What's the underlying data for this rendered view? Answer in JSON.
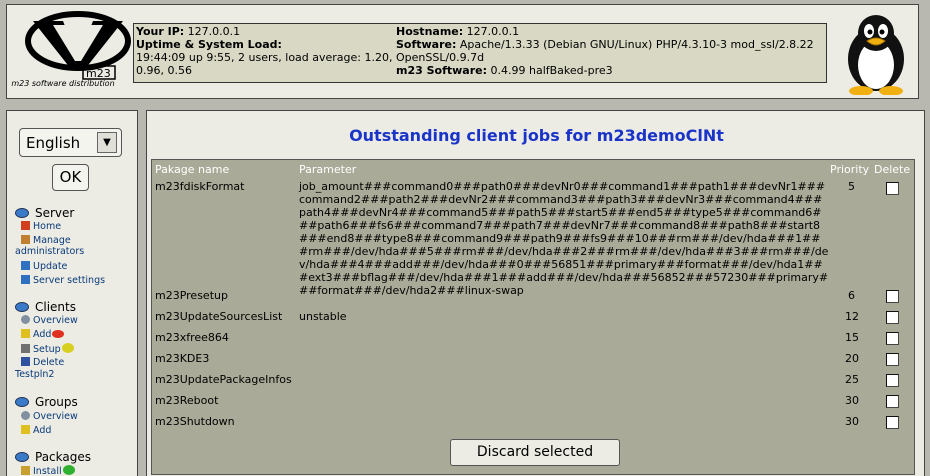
{
  "header": {
    "logo_text": "m23 software distribution",
    "your_ip_label": "Your IP:",
    "your_ip": "127.0.0.1",
    "uptime_label": "Uptime & System Load:",
    "uptime": "19:44:09 up 9:55, 2 users, load average: 1.20, 0.96, 0.56",
    "hostname_label": "Hostname:",
    "hostname": "127.0.0.1",
    "software_label": "Software:",
    "software": "Apache/1.3.33 (Debian GNU/Linux) PHP/4.3.10-3 mod_ssl/2.8.22 OpenSSL/0.9.7d",
    "m23_label": "m23 Software:",
    "m23_version": "0.4.99 halfBaked-pre3"
  },
  "sidebar": {
    "language": "English",
    "ok_label": "OK",
    "server": {
      "label": "Server",
      "items": [
        "Home",
        "Manage administrators",
        "Update",
        "Server settings"
      ]
    },
    "clients": {
      "label": "Clients",
      "items": [
        "Overview",
        "Add",
        "Setup",
        "Delete Testpln2"
      ]
    },
    "groups": {
      "label": "Groups",
      "items": [
        "Overview",
        "Add"
      ]
    },
    "packages": {
      "label": "Packages",
      "items": [
        "Install"
      ]
    }
  },
  "main": {
    "title": "Outstanding client jobs for m23demoClNt",
    "columns": [
      "Pakage name",
      "Parameter",
      "Priority",
      "Delete"
    ],
    "rows": [
      {
        "name": "m23fdiskFormat",
        "parameter": "job_amount###command0###path0###devNr0###command1###path1###devNr1###command2###path2###devNr2###command3###path3###devNr3###command4###path4###devNr4###command5###path5###start5###end5###type5###command6###path6###fs6###command7###path7###devNr7###command8###path8###start8###end8###type8###command9###path9###fs9###10###rm###/dev/hda###1###rm###/dev/hda###5###rm###/dev/hda###2###rm###/dev/hda###3###rm###/dev/hda###4###add###/dev/hda###0###56851###primary###format###/dev/hda1###ext3###bflag###/dev/hda###1###add###/dev/hda###56852###57230###primary###format###/dev/hda2###linux-swap",
        "priority": "5"
      },
      {
        "name": "m23Presetup",
        "parameter": "",
        "priority": "6"
      },
      {
        "name": "m23UpdateSourcesList",
        "parameter": "unstable",
        "priority": "12"
      },
      {
        "name": "m23xfree864",
        "parameter": "",
        "priority": "15"
      },
      {
        "name": "m23KDE3",
        "parameter": "",
        "priority": "20"
      },
      {
        "name": "m23UpdatePackageInfos",
        "parameter": "",
        "priority": "25"
      },
      {
        "name": "m23Reboot",
        "parameter": "",
        "priority": "30"
      },
      {
        "name": "m23Shutdown",
        "parameter": "",
        "priority": "30"
      }
    ],
    "discard_label": "Discard selected"
  }
}
